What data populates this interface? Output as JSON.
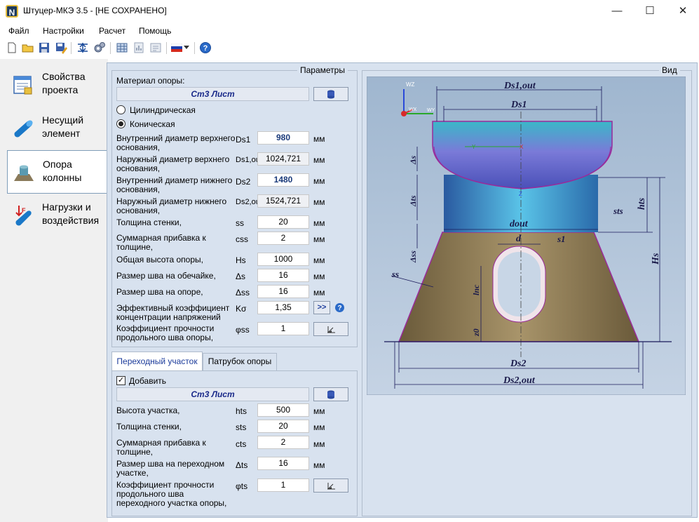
{
  "window": {
    "title": "Штуцер-МКЭ 3.5 - [НЕ СОХРАНЕНО]",
    "icon": "N",
    "minimize": "—",
    "maximize": "☐",
    "close": "✕"
  },
  "menu": [
    "Файл",
    "Настройки",
    "Расчет",
    "Помощь"
  ],
  "sidebar": [
    {
      "label": "Свойства проекта",
      "l1": "Свойства",
      "l2": "проекта"
    },
    {
      "label": "Несущий элемент",
      "l1": "Несущий",
      "l2": "элемент"
    },
    {
      "label": "Опора колонны",
      "l1": "Опора",
      "l2": "колонны"
    },
    {
      "label": "Нагрузки и воздействия",
      "l1": "Нагрузки и",
      "l2": "воздействия"
    }
  ],
  "params": {
    "group_title": "Параметры",
    "material_label": "Материал опоры:",
    "material_value": "Ст3 Лист",
    "radio_cyl": "Цилиндрическая",
    "radio_con": "Коническая",
    "rows": [
      {
        "l1": "Внутренний диаметр верхнего",
        "l2": "основания,",
        "sym": "Ds1",
        "value": "980",
        "unit": "мм"
      },
      {
        "l1": "Наружный диаметр верхнего",
        "l2": "основания,",
        "sym": "Ds1,out",
        "value": "1024,721",
        "unit": "мм"
      },
      {
        "l1": "Внутренний диаметр нижнего",
        "l2": "основания,",
        "sym": "Ds2",
        "value": "1480",
        "unit": "мм"
      },
      {
        "l1": "Наружный диаметр нижнего",
        "l2": "основания,",
        "sym": "Ds2,out",
        "value": "1524,721",
        "unit": "мм"
      },
      {
        "l1": "Толщина стенки,",
        "l2": "",
        "sym": "ss",
        "value": "20",
        "unit": "мм"
      },
      {
        "l1": "Суммарная прибавка к",
        "l2": "толщине,",
        "sym": "css",
        "value": "2",
        "unit": "мм"
      },
      {
        "l1": "Общая высота опоры,",
        "l2": "",
        "sym": "Hs",
        "value": "1000",
        "unit": "мм"
      },
      {
        "l1": "Размер шва на обечайке,",
        "l2": "",
        "sym": "Δs",
        "value": "16",
        "unit": "мм"
      },
      {
        "l1": "Размер шва на опоре,",
        "l2": "",
        "sym": "Δss",
        "value": "16",
        "unit": "мм"
      },
      {
        "l1": "Эффективный коэффициент",
        "l2": "концентрации напряжений",
        "sym": "Kσ",
        "value": "1,35",
        "unit": ">>"
      },
      {
        "l1": "Коэффициент прочности",
        "l2": "продольного шва опоры,",
        "sym": "φss",
        "value": "1",
        "unit": ""
      }
    ]
  },
  "tabs": [
    "Переходный участок",
    "Патрубок опоры"
  ],
  "transition": {
    "add_label": "Добавить",
    "check": "✓",
    "material_value": "Ст3 Лист",
    "rows": [
      {
        "l1": "Высота участка,",
        "l2": "",
        "l3": "",
        "sym": "hts",
        "value": "500",
        "unit": "мм"
      },
      {
        "l1": "Толщина стенки,",
        "l2": "",
        "l3": "",
        "sym": "sts",
        "value": "20",
        "unit": "мм"
      },
      {
        "l1": "Суммарная прибавка к",
        "l2": "толщине,",
        "l3": "",
        "sym": "cts",
        "value": "2",
        "unit": "мм"
      },
      {
        "l1": "Размер шва на переходном",
        "l2": "участке,",
        "l3": "",
        "sym": "Δts",
        "value": "16",
        "unit": "мм"
      },
      {
        "l1": "Коэффициент прочности",
        "l2": "продольного шва",
        "l3": "переходного участка опоры,",
        "sym": "φts",
        "value": "1",
        "unit": ""
      }
    ]
  },
  "view": {
    "group_title": "Вид",
    "labels": {
      "Ds1out": "Ds1,out",
      "Ds1": "Ds1",
      "Ds2": "Ds2",
      "Ds2out": "Ds2,out",
      "dout": "dout",
      "d": "d",
      "s1": "s1",
      "sts": "sts",
      "hts": "hts",
      "Hs": "Hs",
      "ss": "ss",
      "lnc": "lnc",
      "z0": "z0",
      "Ds": "Δs",
      "Dts": "Δts",
      "Dss": "Δss",
      "wz": "WZ",
      "wy": "WY",
      "wx": "WX",
      "x": "X",
      "y": "Y",
      "z": "Z"
    }
  }
}
